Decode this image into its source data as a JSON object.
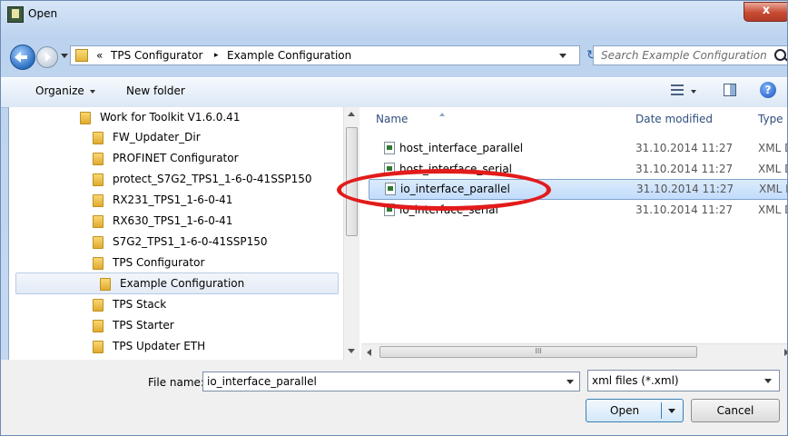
{
  "window": {
    "title": "Open",
    "close_glyph": "x"
  },
  "address": {
    "overflow": "«",
    "crumbs": [
      "TPS Configurator",
      "Example Configuration"
    ],
    "separator": "▸",
    "refresh_glyph": "↻"
  },
  "search": {
    "placeholder": "Search Example Configuration"
  },
  "toolbar": {
    "organize_label": "Organize",
    "new_folder_label": "New folder",
    "help_glyph": "?"
  },
  "tree": {
    "items": [
      "Work for Toolkit V1.6.0.41",
      "FW_Updater_Dir",
      "PROFINET Configurator",
      "protect_S7G2_TPS1_1-6-0-41SSP150",
      "RX231_TPS1_1-6-0-41",
      "RX630_TPS1_1-6-0-41",
      "S7G2_TPS1_1-6-0-41SSP150",
      "TPS Configurator",
      "Example Configuration",
      "TPS Stack",
      "TPS Starter",
      "TPS Updater ETH"
    ],
    "selected": "Example Configuration"
  },
  "files": {
    "columns": [
      "Name",
      "Date modified",
      "Type"
    ],
    "rows": [
      {
        "name": "host_interface_parallel",
        "date": "31.10.2014 11:27",
        "type": "XML D"
      },
      {
        "name": "host_interface_serial",
        "date": "31.10.2014 11:27",
        "type": "XML D"
      },
      {
        "name": "io_interface_parallel",
        "date": "31.10.2014 11:27",
        "type": "XML D"
      },
      {
        "name": "io_interface_serial",
        "date": "31.10.2014 11:27",
        "type": "XML D"
      }
    ],
    "selected": "io_interface_parallel",
    "scroll_grip": "III"
  },
  "bottom": {
    "filename_label": "File name:",
    "filename_value": "io_interface_parallel",
    "filter_value": "xml files (*.xml)",
    "open_label": "Open",
    "cancel_label": "Cancel"
  },
  "colors": {
    "annotation": "#e21b1b",
    "selection": "#c1dcfc"
  }
}
